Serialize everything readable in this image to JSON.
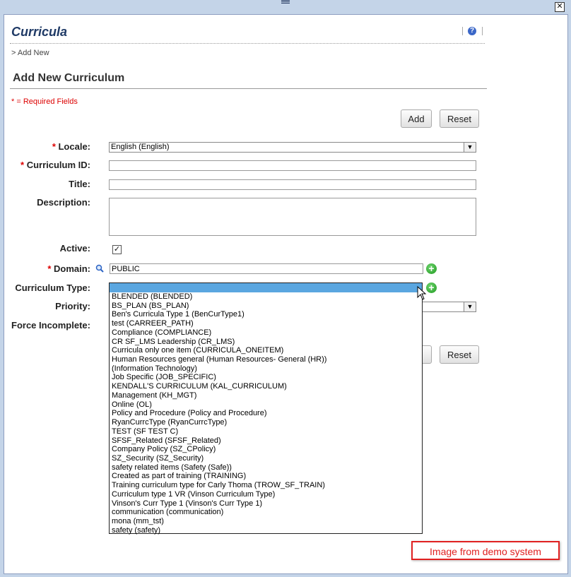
{
  "page": {
    "title": "Curricula",
    "breadcrumb": "> Add New",
    "section_title": "Add New Curriculum",
    "required_note": "* = Required Fields"
  },
  "buttons": {
    "add": "Add",
    "reset": "Reset",
    "reset_bottom": "Reset"
  },
  "form": {
    "locale": {
      "label": "Locale:",
      "value": "English (English)"
    },
    "curriculum_id": {
      "label": "Curriculum ID:",
      "value": ""
    },
    "title": {
      "label": "Title:",
      "value": ""
    },
    "description": {
      "label": "Description:",
      "value": ""
    },
    "active": {
      "label": "Active:",
      "checked": true
    },
    "domain": {
      "label": "Domain:",
      "value": "PUBLIC"
    },
    "curriculum_type": {
      "label": "Curriculum Type:",
      "value": ""
    },
    "priority": {
      "label": "Priority:"
    },
    "force_incomplete": {
      "label": "Force Incomplete:"
    }
  },
  "curriculum_type_options": [
    "BLENDED (BLENDED)",
    "BS_PLAN (BS_PLAN)",
    "Ben's Curricula Type 1 (BenCurType1)",
    "test (CARREER_PATH)",
    "Compliance (COMPLIANCE)",
    "CR SF_LMS Leadership (CR_LMS)",
    "Curricula only one item (CURRICULA_ONEITEM)",
    "Human Resources general (Human Resources- General (HR))",
    "(Information Technology)",
    "Job Specific (JOB_SPECIFIC)",
    "KENDALL'S CURRICULUM (KAL_CURRICULUM)",
    "Management (KH_MGT)",
    "Online (OL)",
    "Policy and Procedure (Policy and Procedure)",
    "RyanCurrcType (RyanCurrcType)",
    "TEST (SF TEST C)",
    "SFSF_Related (SFSF_Related)",
    "Company Policy (SZ_CPolicy)",
    "SZ_Security (SZ_Security)",
    "safety related items (Safety (Safe))",
    "Created as part of training (TRAINING)",
    "Training curriculum type for Carly Thoma (TROW_SF_TRAIN)",
    "Curriculum type 1 VR (Vinson Curriculum Type)",
    "Vinson's Curr Type 1 (Vinson's Curr Type 1)",
    "communication (communication)",
    "mona (mm_tst)",
    "safety (safety)"
  ],
  "badge": "Image from demo system",
  "icons": {
    "close": "close-icon",
    "help": "help-icon",
    "search": "magnifier-icon",
    "add": "plus-icon",
    "dropdown": "chevron-down-icon",
    "check": "checkmark-icon"
  },
  "colors": {
    "page_title": "#1f3a66",
    "required": "#dd0000",
    "dropdown_highlight": "#5aa6e0",
    "badge_border": "#e02020"
  }
}
